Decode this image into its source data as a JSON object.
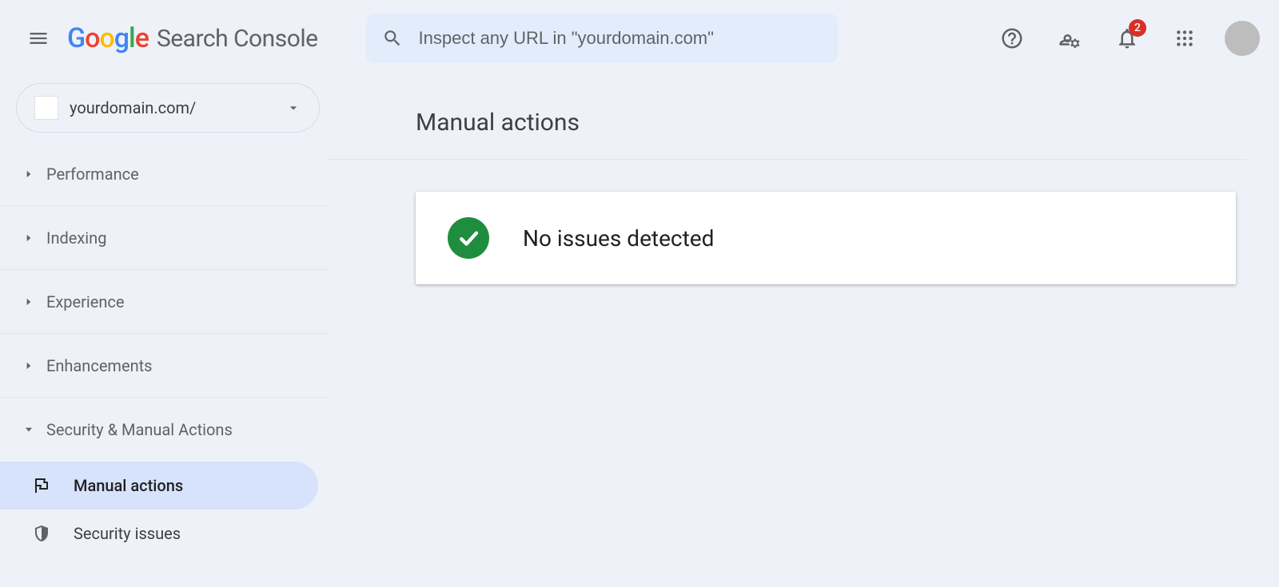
{
  "header": {
    "product_name": "Search Console",
    "search_placeholder": "Inspect any URL in \"yourdomain.com\"",
    "notification_count": "2"
  },
  "sidebar": {
    "property": "yourdomain.com/",
    "items": [
      {
        "label": "Performance"
      },
      {
        "label": "Indexing"
      },
      {
        "label": "Experience"
      },
      {
        "label": "Enhancements"
      },
      {
        "label": "Security & Manual Actions"
      }
    ],
    "subitems": [
      {
        "label": "Manual actions"
      },
      {
        "label": "Security issues"
      }
    ]
  },
  "main": {
    "title": "Manual actions",
    "status_message": "No issues detected"
  }
}
